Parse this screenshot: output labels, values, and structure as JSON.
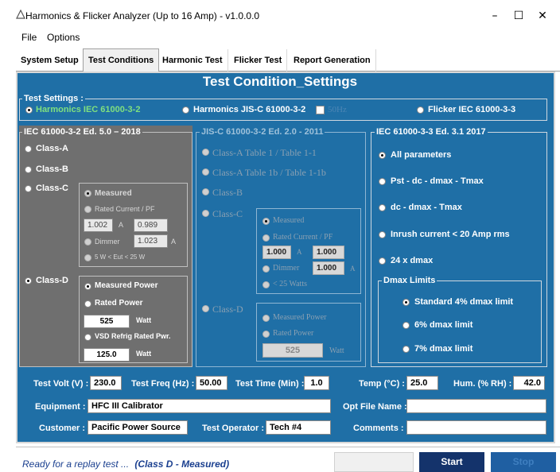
{
  "window": {
    "title": "Harmonics & Flicker Analyzer (Up to 16 Amp) - v1.0.0.0",
    "minimize": "–",
    "maximize": "☐",
    "close": "✕"
  },
  "menu": [
    "File",
    "Options"
  ],
  "tabs": [
    "System Setup",
    "Test Conditions",
    "Harmonic Test",
    "Flicker Test",
    "Report Generation"
  ],
  "page_title": "Test Condition_Settings",
  "test_settings": {
    "label": "Test Settings :",
    "options": [
      "Harmonics IEC 61000-3-2",
      "Harmonics JIS-C 61000-3-2",
      "Flicker IEC 61000-3-3"
    ],
    "jis_check_label": "50Hz",
    "selected": "Harmonics IEC 61000-3-2"
  },
  "iec_harm": {
    "title": "IEC 61000-3-2 Ed. 5.0 – 2018",
    "classes": [
      "Class-A",
      "Class-B",
      "Class-C",
      "Class-D"
    ],
    "selected": "Class-D",
    "class_c": {
      "measured": "Measured",
      "rated": "Rated Current / PF",
      "current": "1.002",
      "unit_a": "A",
      "pf": "0.989",
      "dimmer": "Dimmer",
      "dimmer_val": "1.023",
      "unit_a2": "A",
      "range": "5 W < Eut < 25 W"
    },
    "class_d": {
      "measured_power": "Measured Power",
      "rated_power": "Rated Power",
      "rated_val": "525",
      "unit_w": "Watt",
      "vsd": "VSD Refrig Rated Pwr.",
      "vsd_val": "125.0",
      "unit_w2": "Watt"
    }
  },
  "jis": {
    "title": "JIS-C 61000-3-2 Ed. 2.0 - 2011",
    "class_a": "Class-A Table 1 / Table 1-1",
    "class_a2": "Class-A Table 1b / Table 1-1b",
    "class_b": "Class-B",
    "class_c": "Class-C",
    "class_d": "Class-D",
    "measured": "Measured",
    "rated": "Rated Current / PF",
    "current": "1.000",
    "unit_a": "A",
    "pf": "1.000",
    "dimmer": "Dimmer",
    "dimmer_val": "1.000",
    "unit_a2": "A",
    "range": "< 25 Watts",
    "measured_power": "Measured Power",
    "rated_power": "Rated Power",
    "rated_val": "525",
    "unit_w": "Watt"
  },
  "flicker": {
    "title": "IEC 61000-3-3 Ed. 3.1 2017",
    "options": [
      "All parameters",
      "Pst - dc - dmax - Tmax",
      "dc - dmax - Tmax",
      "Inrush current < 20 Amp rms",
      "24 x dmax"
    ],
    "selected": "All parameters",
    "dmax_title": "Dmax Limits",
    "dmax_options": [
      "Standard 4% dmax limit",
      "6% dmax limit",
      "7% dmax limit"
    ],
    "dmax_selected": "Standard 4% dmax limit"
  },
  "params": {
    "volt_label": "Test Volt (V) :",
    "volt": "230.0",
    "freq_label": "Test Freq (Hz) :",
    "freq": "50.00",
    "time_label": "Test Time (Min) :",
    "time": "1.0",
    "temp_label": "Temp (°C) :",
    "temp": "25.0",
    "hum_label": "Hum. (% RH) :",
    "hum": "42.0",
    "equip_label": "Equipment :",
    "equip": "HFC III Calibrator",
    "optfile_label": "Opt File Name :",
    "optfile": "",
    "customer_label": "Customer :",
    "customer": "Pacific Power Source",
    "operator_label": "Test Operator :",
    "operator": "Tech #4",
    "comments_label": "Comments :",
    "comments": ""
  },
  "status": {
    "text": "Ready for a replay test ...",
    "mode": "(Class D - Measured)",
    "start": "Start",
    "stop": "Stop"
  }
}
